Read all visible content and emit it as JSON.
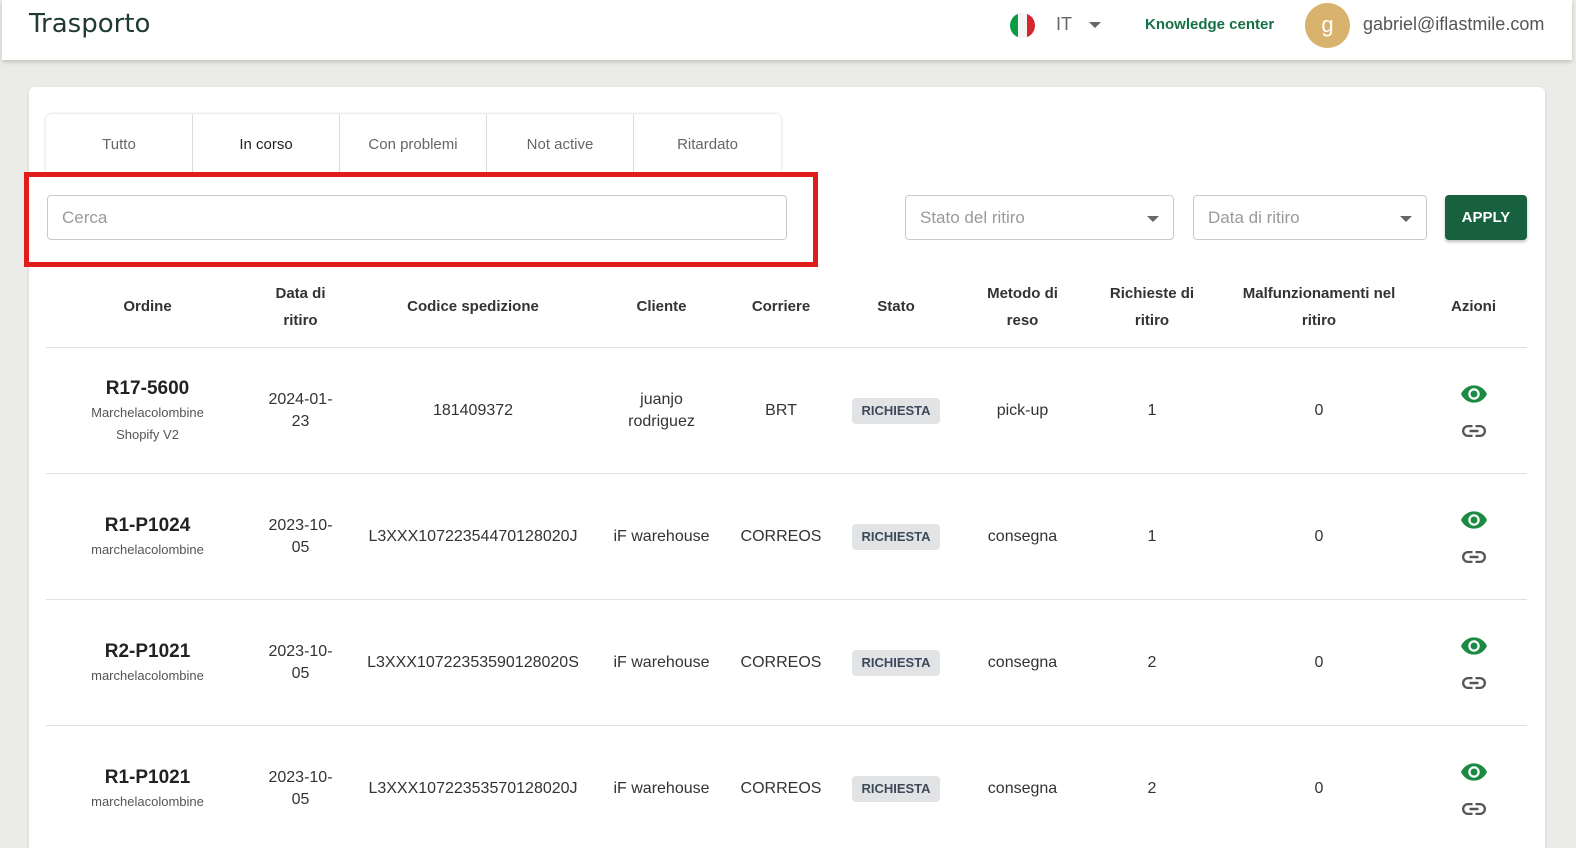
{
  "header": {
    "title": "Trasporto",
    "language": "IT",
    "knowledge_center": "Knowledge center",
    "avatar_letter": "g",
    "user_email": "gabriel@iflastmile.com"
  },
  "tabs": [
    {
      "label": "Tutto"
    },
    {
      "label": "In corso"
    },
    {
      "label": "Con problemi"
    },
    {
      "label": "Not active"
    },
    {
      "label": "Ritardato"
    }
  ],
  "filters": {
    "search_placeholder": "Cerca",
    "status_placeholder": "Stato del ritiro",
    "date_placeholder": "Data di ritiro",
    "apply_label": "APPLY"
  },
  "table": {
    "headers": {
      "ordine": "Ordine",
      "data_1": "Data di",
      "data_2": "ritiro",
      "codice": "Codice spedizione",
      "cliente": "Cliente",
      "corriere": "Corriere",
      "stato": "Stato",
      "metodo_1": "Metodo di",
      "metodo_2": "reso",
      "richieste_1": "Richieste di",
      "richieste_2": "ritiro",
      "malf_1": "Malfunzionamenti nel",
      "malf_2": "ritiro",
      "azioni": "Azioni"
    },
    "rows": [
      {
        "order": "R17-5600",
        "shop_1": "Marchelacolombine",
        "shop_2": "Shopify V2",
        "date_1": "2024-01-",
        "date_2": "23",
        "code": "181409372",
        "client_1": "juanjo",
        "client_2": "rodriguez",
        "carrier": "BRT",
        "status": "RICHIESTA",
        "method": "pick-up",
        "requests": "1",
        "failures": "0"
      },
      {
        "order": "R1-P1024",
        "shop_1": "marchelacolombine",
        "shop_2": "",
        "date_1": "2023-10-",
        "date_2": "05",
        "code": "L3XXX10722354470128020J",
        "client_1": "iF warehouse",
        "client_2": "",
        "carrier": "CORREOS",
        "status": "RICHIESTA",
        "method": "consegna",
        "requests": "1",
        "failures": "0"
      },
      {
        "order": "R2-P1021",
        "shop_1": "marchelacolombine",
        "shop_2": "",
        "date_1": "2023-10-",
        "date_2": "05",
        "code": "L3XXX10722353590128020S",
        "client_1": "iF warehouse",
        "client_2": "",
        "carrier": "CORREOS",
        "status": "RICHIESTA",
        "method": "consegna",
        "requests": "2",
        "failures": "0"
      },
      {
        "order": "R1-P1021",
        "shop_1": "marchelacolombine",
        "shop_2": "",
        "date_1": "2023-10-",
        "date_2": "05",
        "code": "L3XXX10722353570128020J",
        "client_1": "iF warehouse",
        "client_2": "",
        "carrier": "CORREOS",
        "status": "RICHIESTA",
        "method": "consegna",
        "requests": "2",
        "failures": "0"
      }
    ]
  },
  "colors": {
    "brand_green": "#17613f",
    "link_green": "#167047",
    "eye_icon": "#1b8a43",
    "highlight_red": "#e21b1b",
    "avatar": "#d9b36d"
  },
  "icons": [
    "italy-flag-icon",
    "chevron-down-icon",
    "eye-icon",
    "link-icon"
  ]
}
